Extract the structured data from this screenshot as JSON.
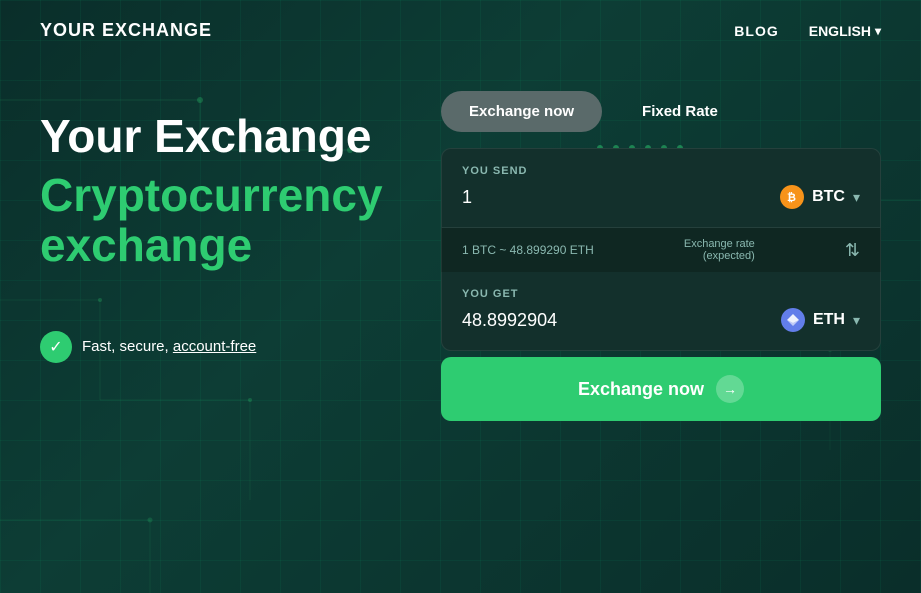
{
  "header": {
    "logo": "YOUR EXCHANGE",
    "nav": {
      "blog_label": "BLOG",
      "lang_label": "ENGLISH",
      "lang_chevron": "▾"
    }
  },
  "hero": {
    "title_line1": "Your Exchange",
    "title_line2": "Cryptocurrency",
    "title_line3": "exchange",
    "feature_text": "Fast, secure, ",
    "feature_link": "account-free"
  },
  "tabs": {
    "active": "Exchange now",
    "inactive": "Fixed Rate"
  },
  "send_field": {
    "label": "YOU SEND",
    "value": "1",
    "currency": "BTC",
    "currency_symbol": "₿"
  },
  "info_bar": {
    "rate_text": "1 BTC ~ 48.899290 ETH",
    "rate_label": "Exchange rate",
    "rate_sublabel": "(expected)"
  },
  "get_field": {
    "label": "YOU GET",
    "value": "48.8992904",
    "currency": "ETH",
    "currency_symbol": "◈"
  },
  "exchange_button": {
    "label": "Exchange now",
    "arrow": "→"
  },
  "colors": {
    "accent": "#2ecc71",
    "bg_dark": "#0a2e2a",
    "card_bg": "#0d3530"
  }
}
